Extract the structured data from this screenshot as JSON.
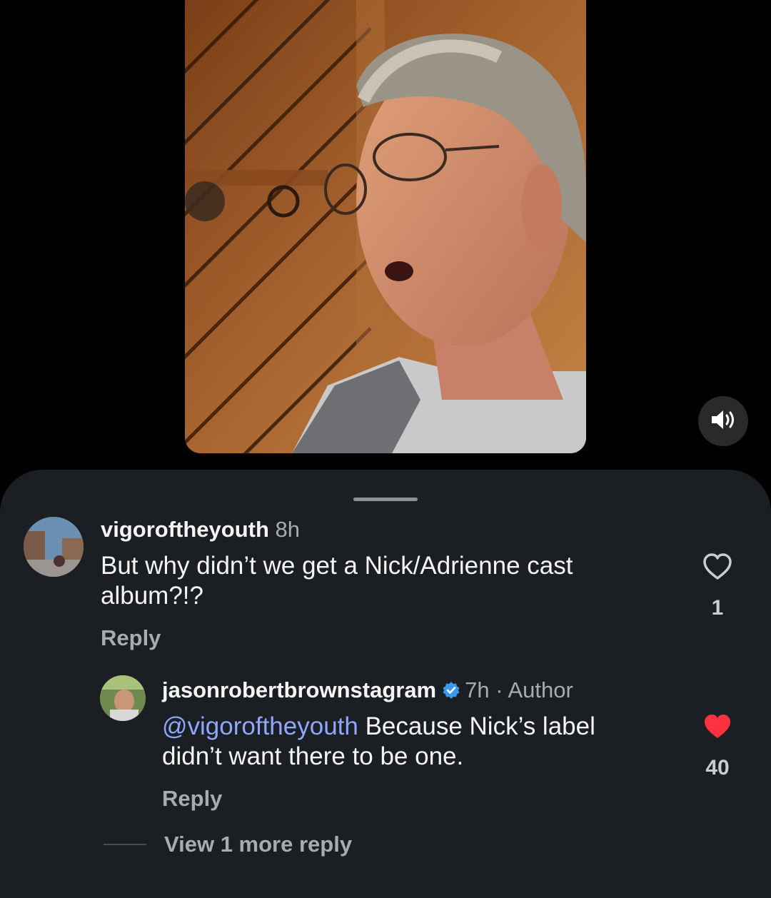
{
  "video": {
    "mute_icon": "speaker-icon"
  },
  "comments": [
    {
      "username": "vigoroftheyouth",
      "time": "8h",
      "text": "But why didn’t we get a Nick/Adrienne cast album?!?",
      "text_line1": "But why didn’t we get a Nick/Adrienne cast",
      "text_line2": "album?!?",
      "reply_label": "Reply",
      "like_count": "1",
      "liked": false
    },
    {
      "username": "jasonrobertbrownstagram",
      "verified": true,
      "time": "7h",
      "separator": "·",
      "role": "Author",
      "mention": "@vigoroftheyouth",
      "text_after_mention": " Because Nick’s label",
      "text_line2": "didn’t want there to be one.",
      "reply_label": "Reply",
      "like_count": "40",
      "liked": true
    }
  ],
  "view_more_label": "View 1 more reply",
  "colors": {
    "sheet_bg": "#1b1e22",
    "mention": "#8fa7ff",
    "liked_heart": "#ff3040",
    "verified": "#3897f0"
  }
}
